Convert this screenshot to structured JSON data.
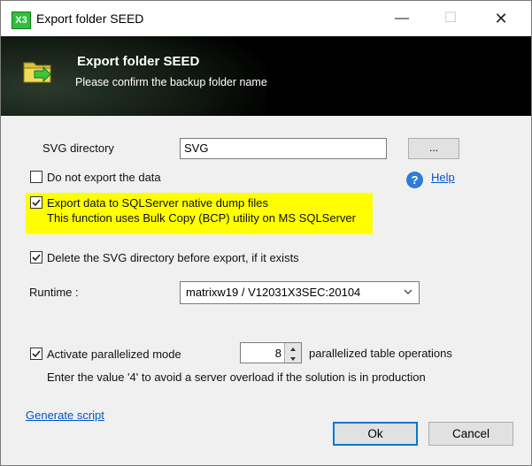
{
  "window": {
    "title": "Export folder SEED",
    "app_icon_text": "X3",
    "controls": {
      "minimize": "—",
      "maximize": "☐",
      "close": "✕"
    }
  },
  "banner": {
    "title": "Export folder SEED",
    "subtitle": "Please confirm the backup folder name"
  },
  "svg_directory": {
    "label": "SVG directory",
    "value": "SVG",
    "browse_label": "..."
  },
  "options": {
    "no_export": {
      "label": "Do not export the data",
      "checked": false
    },
    "native_dump": {
      "label": "Export data to SQLServer native dump files",
      "note": "This function uses Bulk Copy (BCP) utility on MS SQLServer",
      "checked": true,
      "highlight_color": "#ffff00"
    },
    "delete_svg": {
      "label": "Delete the SVG directory before export, if it exists",
      "checked": true
    }
  },
  "help": {
    "label": "Help"
  },
  "runtime": {
    "label": "Runtime :",
    "selected": "matrixw19 / V12031X3SEC:20104"
  },
  "parallel": {
    "label": "Activate parallelized mode",
    "checked": true,
    "value": "8",
    "suffix": "parallelized table operations",
    "note": "Enter the value '4' to avoid a server overload if the solution is in production"
  },
  "footer": {
    "generate_script": "Generate script",
    "ok": "Ok",
    "cancel": "Cancel"
  },
  "colors": {
    "accent": "#0078d7",
    "link": "#0055cc",
    "highlight": "#ffff00",
    "banner_bg": "#000000"
  }
}
